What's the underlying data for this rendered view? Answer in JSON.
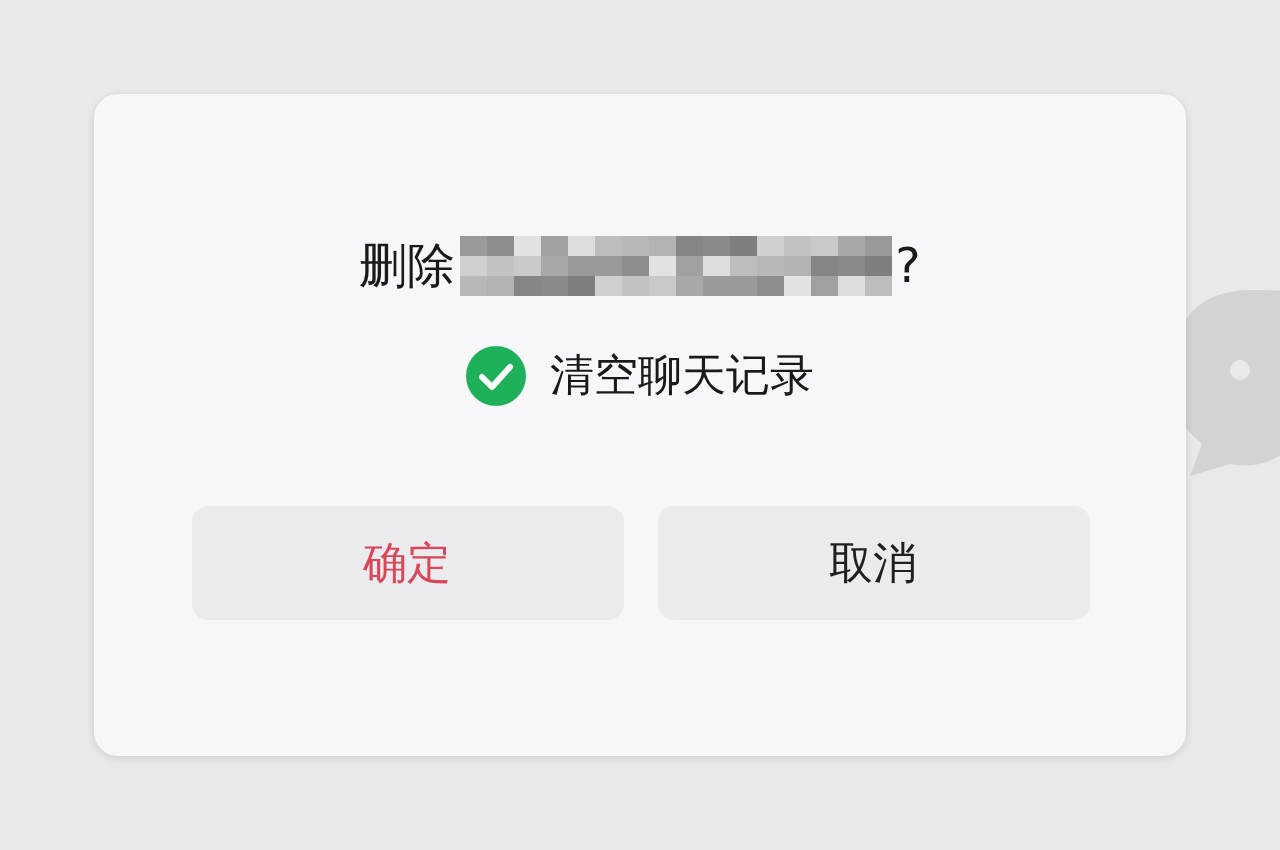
{
  "dialog": {
    "title_prefix": "删除",
    "title_suffix": "?",
    "checkbox": {
      "label": "清空聊天记录",
      "checked": true
    },
    "buttons": [
      {
        "label": "确定",
        "kind": "danger"
      },
      {
        "label": "取消",
        "kind": "normal"
      }
    ]
  }
}
